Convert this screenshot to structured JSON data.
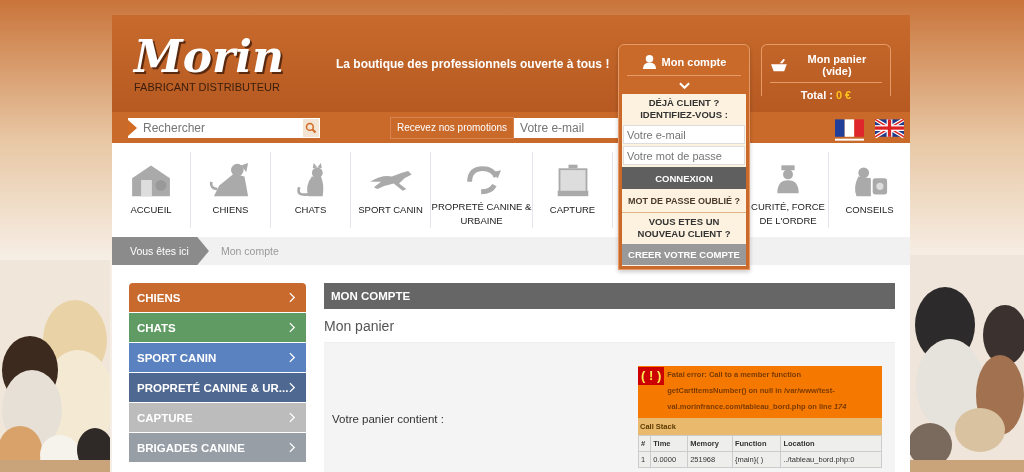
{
  "header": {
    "logo": "Morin",
    "logo_subtitle": "FABRICANT DISTRIBUTEUR",
    "tagline": "La boutique des professionnels ouverte à tous !",
    "account": {
      "label": "Mon compte",
      "expanded": true
    },
    "cart": {
      "label": "Mon panier (vide)",
      "total_label": "Total :",
      "total_value": "0 €"
    }
  },
  "toolbar": {
    "search": {
      "placeholder": "Rechercher"
    },
    "newsletter": {
      "label": "Recevez nos promotions",
      "placeholder": "Votre e-mail"
    },
    "languages": [
      {
        "kind": "fr",
        "selected": true
      },
      {
        "kind": "en",
        "selected": false
      }
    ]
  },
  "account_menu": {
    "login_heading": "DÉJÀ CLIENT ? IDENTIFIEZ-VOUS :",
    "email_placeholder": "Votre e-mail",
    "password_placeholder": "Votre mot de passe",
    "login_button": "CONNEXION",
    "forgot_link": "MOT DE PASSE OUBLIÉ ?",
    "new_heading": "VOUS ETES UN NOUVEAU CLIENT ?",
    "create_button": "CREER VOTRE COMPTE"
  },
  "nav": [
    {
      "kind": "house",
      "label": "ACCUEIL"
    },
    {
      "kind": "dog",
      "label": "CHIENS"
    },
    {
      "kind": "cat",
      "label": "CHATS"
    },
    {
      "kind": "runner",
      "label": "SPORT CANIN"
    },
    {
      "kind": "recycle",
      "label": "PROPRETÉ CANINE & URBAINE"
    },
    {
      "kind": "cage",
      "label": "CAPTURE"
    },
    {
      "kind": "officer",
      "label": "CURITÉ, FORCE DE L'ORDRE"
    },
    {
      "kind": "pets",
      "label": "CONSEILS"
    }
  ],
  "breadcrumb": {
    "lead": "Vous êtes ici",
    "current": "Mon compte"
  },
  "sidebar": {
    "items": [
      {
        "label": "CHIENS",
        "color": "#c8692e"
      },
      {
        "label": "CHATS",
        "color": "#5f9b62"
      },
      {
        "label": "SPORT CANIN",
        "color": "#5b82c0"
      },
      {
        "label": "PROPRETÉ CANINE & UR...",
        "color": "#4f6891"
      },
      {
        "label": "CAPTURE",
        "color": "#bcbcbc"
      },
      {
        "label": "BRIGADES CANINE",
        "color": "#979ea6"
      }
    ]
  },
  "content": {
    "title": "MON COMPTE",
    "subtitle": "Mon panier",
    "cart_label": "Votre panier contient :",
    "error": {
      "icon_text": "( ! )",
      "message": "Fatal error: Call to a member function getCartItemsNumber() on null in /var/www/test-val.morinfrance.com/tableau_bord.php on line *174*",
      "call_stack_title": "Call Stack",
      "columns": [
        "#",
        "Time",
        "Memory",
        "Function",
        "Location"
      ],
      "rows": [
        [
          "1",
          "0.0000",
          "251968",
          "{main}( )",
          "../tableau_bord.php:0"
        ]
      ]
    }
  }
}
